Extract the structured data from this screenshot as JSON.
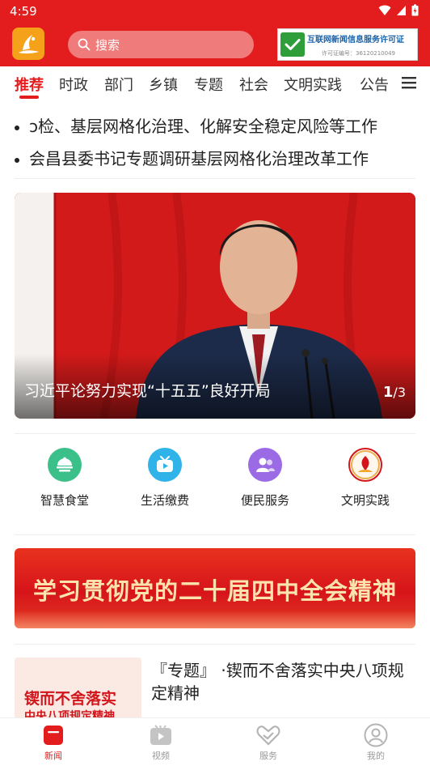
{
  "status_bar": {
    "time": "4:59"
  },
  "header": {
    "search_placeholder": "搜索",
    "license_title": "互联网新闻信息服务许可证",
    "license_number": "许可证编号：36120210049"
  },
  "tabs": [
    {
      "label": "推荐",
      "active": true
    },
    {
      "label": "时政"
    },
    {
      "label": "部门"
    },
    {
      "label": "乡镇"
    },
    {
      "label": "专题"
    },
    {
      "label": "社会"
    },
    {
      "label": "文明实践"
    },
    {
      "label": "公告"
    }
  ],
  "ticker": [
    "ɔ检、基层网格化治理、化解安全稳定风险等工作",
    "会昌县委书记专题调研基层网格化治理改革工作"
  ],
  "carousel": {
    "caption": "习近平论努力实现“十五五”良好开局",
    "current": "1",
    "total": "/3"
  },
  "services": [
    {
      "label": "智慧食堂",
      "icon": "canteen-icon",
      "color": "#3cc08a"
    },
    {
      "label": "生活缴费",
      "icon": "tv-icon",
      "color": "#2fb3e8"
    },
    {
      "label": "便民服务",
      "icon": "people-icon",
      "color": "#9b6be6"
    },
    {
      "label": "文明实践",
      "icon": "civilization-badge-icon",
      "color": "#d3141a"
    }
  ],
  "banner": {
    "text": "学习贯彻党的二十届四中全会精神"
  },
  "article": {
    "thumb_line1": "锲而不舍落实",
    "thumb_line2": "中央八项规定精神",
    "title": "『专题』 ·锲而不舍落实中央八项规定精神"
  },
  "bottom_nav": [
    {
      "label": "新闻",
      "icon": "news-icon",
      "active": true
    },
    {
      "label": "视频",
      "icon": "video-icon"
    },
    {
      "label": "服务",
      "icon": "service-icon"
    },
    {
      "label": "我的",
      "icon": "profile-icon"
    }
  ],
  "colors": {
    "brand_red": "#e31d1e",
    "text_dark": "#222222",
    "nav_gray": "#9a9a9a"
  }
}
